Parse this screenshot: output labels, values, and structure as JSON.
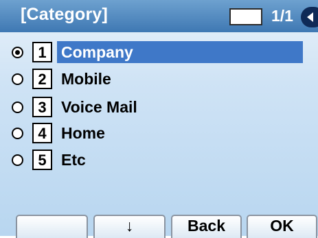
{
  "header": {
    "title": "[Category]",
    "page_indicator": "1/1",
    "scroll_icon": "triangle-left-icon"
  },
  "items": [
    {
      "number": "1",
      "label": "Company",
      "selected": true
    },
    {
      "number": "2",
      "label": "Mobile",
      "selected": false
    },
    {
      "number": "3",
      "label": "Voice Mail",
      "selected": false
    },
    {
      "number": "4",
      "label": "Home",
      "selected": false
    },
    {
      "number": "5",
      "label": "Etc",
      "selected": false
    }
  ],
  "softkeys": [
    {
      "label": ""
    },
    {
      "label": "↓"
    },
    {
      "label": "Back"
    },
    {
      "label": "OK"
    }
  ],
  "colors": {
    "header": "#3f78b3",
    "selection": "#3f78c8",
    "background": "#cfe3f5"
  }
}
